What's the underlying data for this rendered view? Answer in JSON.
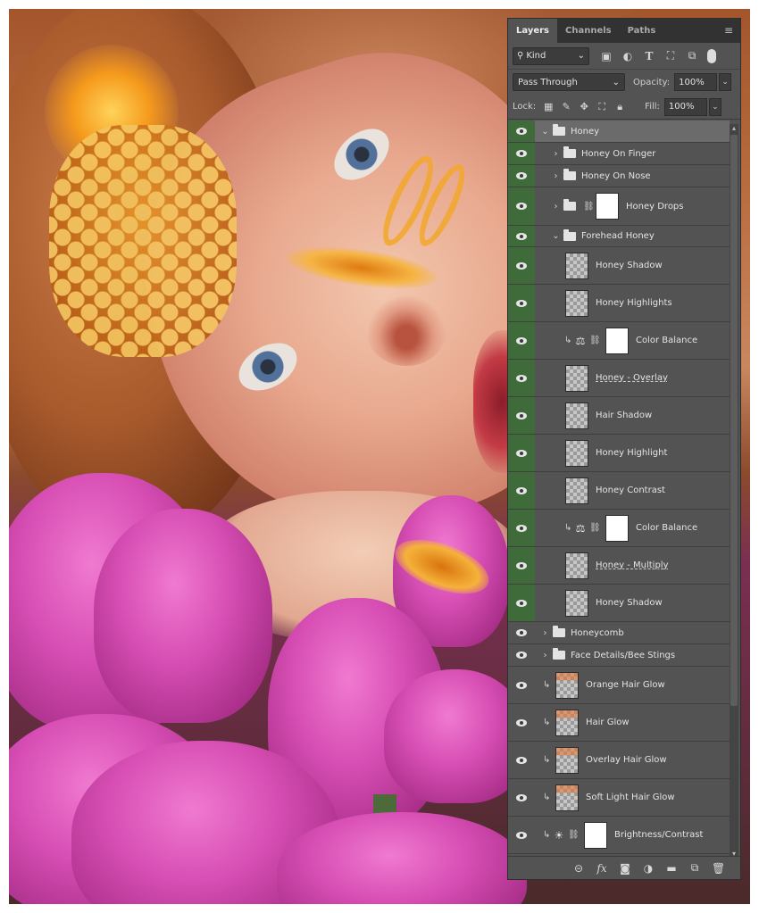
{
  "tabs": [
    {
      "label": "Layers",
      "active": true
    },
    {
      "label": "Channels",
      "active": false
    },
    {
      "label": "Paths",
      "active": false
    }
  ],
  "filter": {
    "kind_label": "Kind",
    "icons": [
      "image-filter-icon",
      "adjustment-filter-icon",
      "type-filter-icon",
      "shape-filter-icon",
      "smart-object-filter-icon"
    ]
  },
  "blend": {
    "mode": "Pass Through",
    "opacity_label": "Opacity:",
    "opacity_value": "100%"
  },
  "lock": {
    "label": "Lock:",
    "fill_label": "Fill:",
    "fill_value": "100%"
  },
  "layers": [
    {
      "name": "Honey",
      "type": "group",
      "indent": 0,
      "expanded": true,
      "selected": true,
      "visible": true,
      "green": true
    },
    {
      "name": "Honey On Finger",
      "type": "group",
      "indent": 1,
      "expanded": false,
      "visible": true,
      "green": true
    },
    {
      "name": "Honey On Nose",
      "type": "group",
      "indent": 1,
      "expanded": false,
      "visible": true,
      "green": true
    },
    {
      "name": "Honey Drops",
      "type": "group-mask",
      "indent": 1,
      "expanded": false,
      "visible": true,
      "green": true
    },
    {
      "name": "Forehead Honey",
      "type": "group",
      "indent": 1,
      "expanded": true,
      "visible": true,
      "green": true
    },
    {
      "name": "Honey Shadow",
      "type": "layer",
      "indent": 2,
      "visible": true,
      "green": true
    },
    {
      "name": "Honey Highlights",
      "type": "layer",
      "indent": 2,
      "visible": true,
      "green": true
    },
    {
      "name": "Color Balance",
      "type": "adjustment",
      "indent": 2,
      "clipped": true,
      "visible": true,
      "green": true
    },
    {
      "name": "Honey - Overlay",
      "type": "layer",
      "indent": 2,
      "underline": true,
      "visible": true,
      "green": true
    },
    {
      "name": "Hair Shadow",
      "type": "layer",
      "indent": 2,
      "visible": true,
      "green": true
    },
    {
      "name": "Honey Highlight",
      "type": "layer",
      "indent": 2,
      "visible": true,
      "green": true
    },
    {
      "name": "Honey Contrast",
      "type": "layer",
      "indent": 2,
      "visible": true,
      "green": true
    },
    {
      "name": "Color Balance",
      "type": "adjustment",
      "indent": 2,
      "clipped": true,
      "visible": true,
      "green": true
    },
    {
      "name": "Honey - Multiply",
      "type": "layer",
      "indent": 2,
      "underline": true,
      "visible": true,
      "green": true
    },
    {
      "name": "Honey Shadow",
      "type": "layer",
      "indent": 2,
      "visible": true,
      "green": true
    },
    {
      "name": "Honeycomb",
      "type": "group",
      "indent": 0,
      "expanded": false,
      "visible": true,
      "green": false
    },
    {
      "name": "Face Details/Bee Stings",
      "type": "group",
      "indent": 0,
      "expanded": false,
      "visible": true,
      "green": false
    },
    {
      "name": "Orange Hair Glow",
      "type": "hair",
      "indent": 0,
      "clipped": true,
      "visible": true,
      "green": false
    },
    {
      "name": "Hair Glow",
      "type": "hair",
      "indent": 0,
      "clipped": true,
      "visible": true,
      "green": false
    },
    {
      "name": "Overlay Hair Glow",
      "type": "hair",
      "indent": 0,
      "clipped": true,
      "visible": true,
      "green": false
    },
    {
      "name": "Soft Light  Hair Glow",
      "type": "hair",
      "indent": 0,
      "clipped": true,
      "visible": true,
      "green": false
    },
    {
      "name": "Brightness/Contrast",
      "type": "brightness",
      "indent": 0,
      "clipped": true,
      "visible": true,
      "green": false
    }
  ],
  "footer_buttons": [
    "link-layers-icon",
    "fx-icon",
    "add-mask-icon",
    "new-adjustment-icon",
    "new-group-icon",
    "new-layer-icon",
    "trash-icon"
  ],
  "footer_fx_label": "fx"
}
